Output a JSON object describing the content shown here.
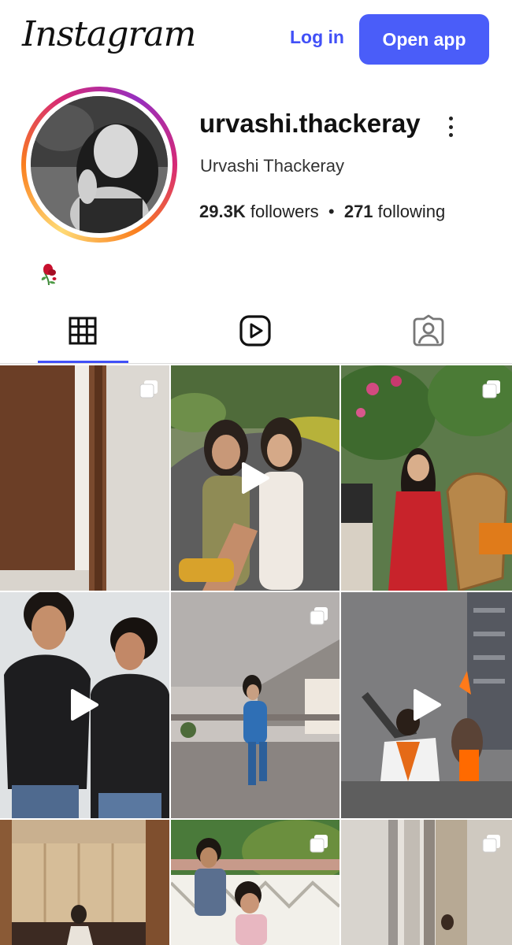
{
  "header": {
    "logo_text": "Instagram",
    "login_label": "Log in",
    "open_app_label": "Open app"
  },
  "profile": {
    "username": "urvashi.thackeray",
    "full_name": "Urvashi Thackeray",
    "followers_count": "29.3K",
    "followers_label": "followers",
    "separator": "•",
    "following_count": "271",
    "following_label": "following",
    "bio_emoji": "wilted-rose"
  },
  "tabs": [
    {
      "name": "posts",
      "icon": "grid-icon",
      "active": true
    },
    {
      "name": "reels",
      "icon": "reels-icon",
      "active": false
    },
    {
      "name": "tagged",
      "icon": "tagged-icon",
      "active": false
    }
  ],
  "grid": [
    {
      "type": "carousel"
    },
    {
      "type": "reel"
    },
    {
      "type": "carousel"
    },
    {
      "type": "reel"
    },
    {
      "type": "carousel"
    },
    {
      "type": "reel"
    },
    {
      "type": "post"
    },
    {
      "type": "carousel"
    },
    {
      "type": "carousel"
    }
  ],
  "colors": {
    "accent": "#4a5df9",
    "text": "#1a1a1a",
    "divider": "#dbdbdb"
  }
}
